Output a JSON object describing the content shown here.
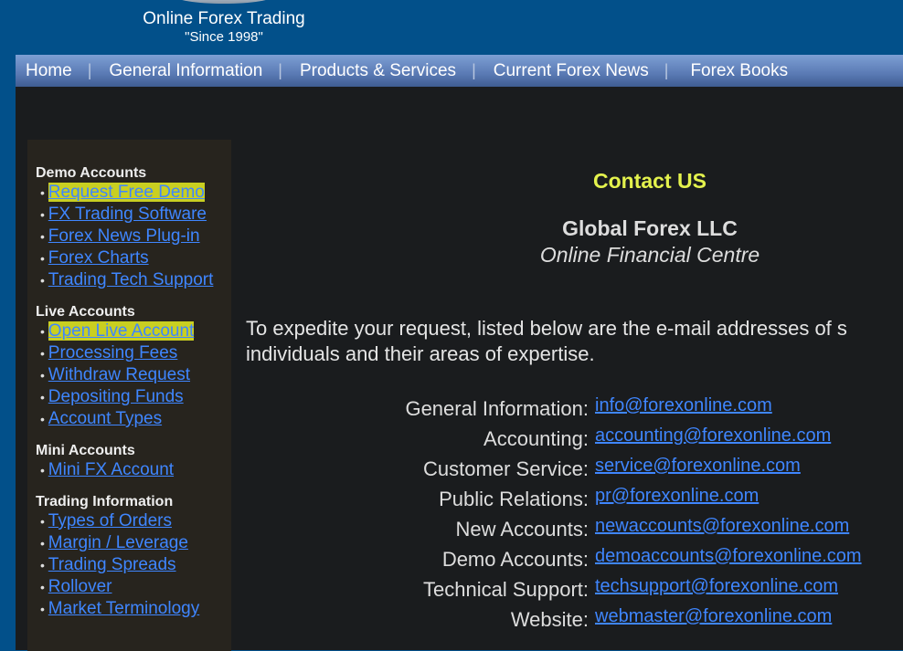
{
  "header": {
    "title": "Online Forex Trading",
    "since": "\"Since 1998\""
  },
  "nav": [
    "Home",
    "General Information",
    "Products & Services",
    "Current Forex News",
    "Forex Books"
  ],
  "sidebar": [
    {
      "title": "Demo Accounts",
      "links": [
        "Request Free Demo",
        "FX Trading Software",
        "Forex News Plug-in",
        "Forex Charts",
        "Trading Tech Support"
      ]
    },
    {
      "title": "Live Accounts",
      "links": [
        "Open Live Account",
        "Processing Fees",
        "Withdraw Request",
        "Depositing Funds",
        "Account Types"
      ]
    },
    {
      "title": "Mini Accounts",
      "links": [
        "Mini FX Account"
      ]
    },
    {
      "title": "Trading Information",
      "links": [
        "Types of Orders",
        "Margin / Leverage",
        "Trading Spreads",
        "Rollover",
        "Market Terminology"
      ]
    }
  ],
  "content": {
    "title": "Contact US",
    "company": "Global Forex LLC",
    "tagline": "Online Financial Centre",
    "intro1": "To expedite your request, listed below are the e-mail addresses of s",
    "intro2": "individuals and their areas of expertise.",
    "contacts": [
      {
        "label": "General Information:",
        "email": "info@forexonline.com"
      },
      {
        "label": "Accounting:",
        "email": "accounting@forexonline.com"
      },
      {
        "label": "Customer Service:",
        "email": "service@forexonline.com"
      },
      {
        "label": "Public Relations:",
        "email": "pr@forexonline.com"
      },
      {
        "label": "New Accounts:",
        "email": "newaccounts@forexonline.com"
      },
      {
        "label": "Demo Accounts:",
        "email": "demoaccounts@forexonline.com"
      },
      {
        "label": "Technical Support:",
        "email": "techsupport@forexonline.com"
      },
      {
        "label": "Website:",
        "email": "webmaster@forexonline.com"
      }
    ]
  }
}
